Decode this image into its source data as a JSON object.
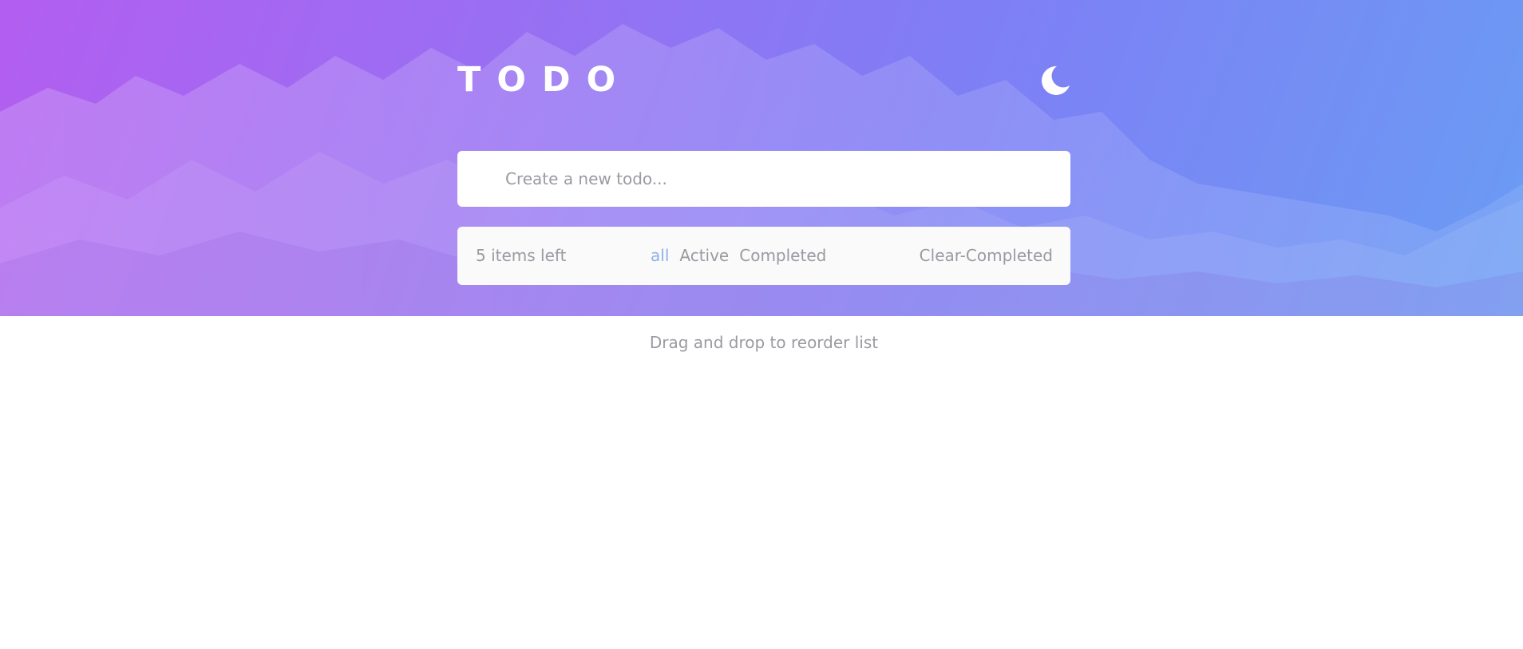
{
  "header": {
    "title": "TODO",
    "theme_toggle_icon": "moon-icon"
  },
  "new_todo": {
    "placeholder": "Create a new todo...",
    "value": ""
  },
  "footer": {
    "items_left": "5 items left",
    "filters": [
      {
        "label": "all",
        "active": true
      },
      {
        "label": "Active",
        "active": false
      },
      {
        "label": "Completed",
        "active": false
      }
    ],
    "clear_label": "Clear-Completed"
  },
  "hint": "Drag and drop to reorder list",
  "colors": {
    "gradient_start": "#b35ef0",
    "gradient_end": "#6a9cf4",
    "active_filter": "#8fb0e6",
    "muted_text": "#9a9aa2"
  }
}
